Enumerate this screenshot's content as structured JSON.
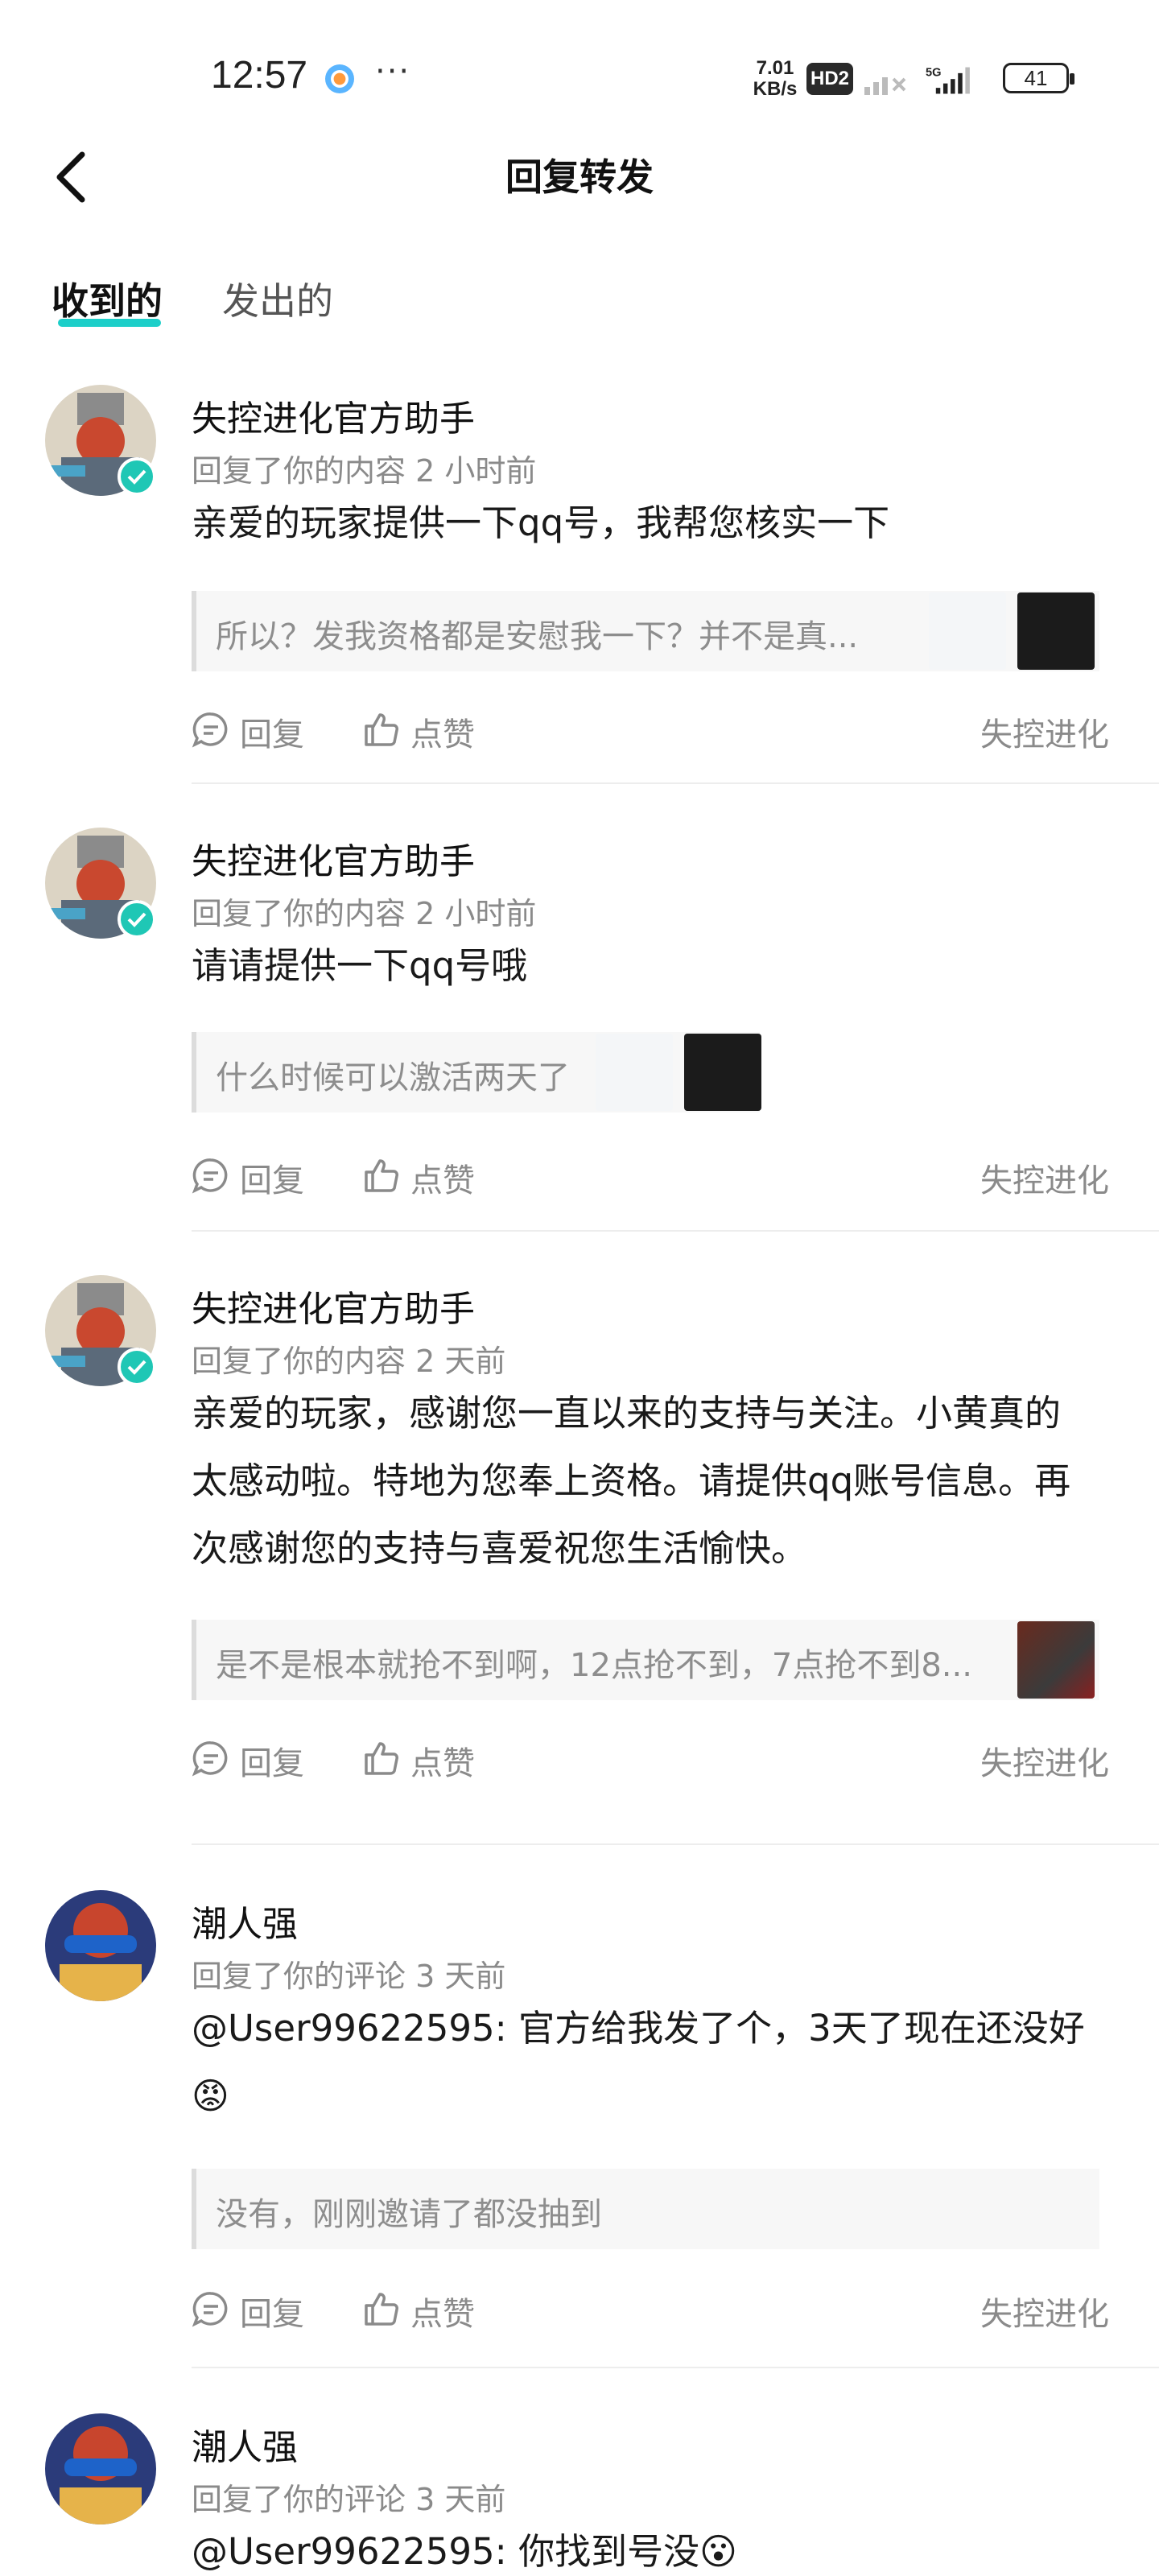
{
  "status_bar": {
    "time": "12:57",
    "more": "···",
    "net_speed_top": "7.01",
    "net_speed_bottom": "KB/s",
    "hd_label": "HD2",
    "network_type": "5G",
    "battery": "41"
  },
  "header": {
    "title": "回复转发"
  },
  "tabs": [
    {
      "label": "收到的",
      "active": true
    },
    {
      "label": "发出的",
      "active": false
    }
  ],
  "items": [
    {
      "name": "失控进化官方助手",
      "verified": true,
      "meta": "回复了你的内容 2 小时前",
      "content": "亲爱的玩家提供一下qq号，我帮您核实一下",
      "quote": "所以？发我资格都是安慰我一下？并不是真...",
      "reply_label": "回复",
      "like_label": "点赞",
      "source": "失控进化"
    },
    {
      "name": "失控进化官方助手",
      "verified": true,
      "meta": "回复了你的内容 2 小时前",
      "content": "请请提供一下qq号哦",
      "quote": "什么时候可以激活两天了",
      "reply_label": "回复",
      "like_label": "点赞",
      "source": "失控进化"
    },
    {
      "name": "失控进化官方助手",
      "verified": true,
      "meta": "回复了你的内容 2 天前",
      "content": "亲爱的玩家，感谢您一直以来的支持与关注。小黄真的太感动啦。特地为您奉上资格。请提供qq账号信息。再次感谢您的支持与喜爱祝您生活愉快。",
      "quote": "是不是根本就抢不到啊，12点抢不到，7点抢不到8...",
      "reply_label": "回复",
      "like_label": "点赞",
      "source": "失控进化"
    },
    {
      "name": "潮人强",
      "verified": false,
      "meta": "回复了你的评论 3 天前",
      "content": "@User99622595: 官方给我发了个，3天了现在还没好😡",
      "quote": "没有，刚刚邀请了都没抽到",
      "reply_label": "回复",
      "like_label": "点赞",
      "source": "失控进化"
    },
    {
      "name": "潮人强",
      "verified": false,
      "meta": "回复了你的评论 3 天前",
      "content": "@User99622595: 你找到号没😮"
    }
  ],
  "colors": {
    "accent": "#1ccfc9",
    "verified_badge": "#1fc7b5",
    "secondary_text": "#8a8a8a",
    "quote_bg": "#f7f7f7"
  }
}
